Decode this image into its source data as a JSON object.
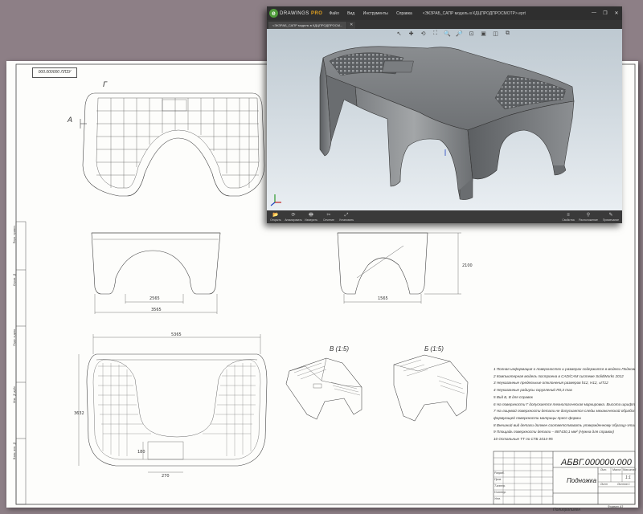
{
  "drawing": {
    "stamp_code": "000.000000 ЛЛЗУ",
    "view_labels": {
      "detail": "Г",
      "section": "А"
    },
    "section_labels": [
      "В (1:5)",
      "Б (1:5)"
    ],
    "dims": {
      "top_width": "2565",
      "top_width2": "3565",
      "side_width": "1565",
      "side_height": "2100",
      "plan_width": "5365",
      "plan_height": "3632",
      "plan_small_w": "270",
      "plan_small_h": "180"
    },
    "notes": [
      "1  Полная информация о поверхностях и размерах содержится в модели Подножка.SLDPRT",
      "2  Компьютерная модель построена в CAD/CAM системе SolidWorks 2012",
      "3  Неуказанные предельные отклонения размеров h12, H12, ±IT12",
      "4  Неуказанные радиусы скруглений R0,3 max",
      "5  Вид Б, В для справок",
      "6  На поверхности Г допускается технологическая маркировка. Высота шрифта 0,5 max",
      "7  На лицевой поверхности детали не допускается следы механической обработки",
      "   формующей поверхности матрицы пресс-формы",
      "8  Внешний вид детали должен соответствовать утвержденному образцу-эталону",
      "9  Площадь поверхности детали – 887430,1 мм² (Нужна для справок)",
      "10  Остальные ТТ по СТБ 1014-95"
    ],
    "title_block": {
      "code": "АБВГ.000000.000",
      "name": "Подножка",
      "material": "Полипропилен",
      "scale": "1:1",
      "sheet": "Лист",
      "sheets": "Листов 1",
      "format": "Формат A3",
      "labels": [
        "Лит.",
        "Масса",
        "Масштаб"
      ],
      "roles": [
        "Разраб.",
        "Пров.",
        "Т.контр.",
        "Н.контр.",
        "Утв."
      ]
    },
    "side_stamp": [
      "Перв. примен.",
      "Справ. №",
      "Подп. и дата",
      "Инв. № дубл.",
      "Взам. инв. №",
      "Подп. и дата",
      "Инв. № подл."
    ]
  },
  "edrawings": {
    "logo_text": "DRAWINGS",
    "logo_pro": "PRO",
    "menu": [
      "Файл",
      "Вид",
      "Инструменты",
      "Справка"
    ],
    "title": "<ЭКЗРАБ_САПР модель в КДЦПРОДПРОСМОТР>.eprt",
    "window_controls": [
      "—",
      "❐",
      "✕"
    ],
    "tab_label": "<ЭКЗРАБ_САПР модель в КДЦПРОДПРОСМ...",
    "tab_close": "✕",
    "bottom_tools": [
      {
        "icon": "📂",
        "label": "Открыть"
      },
      {
        "icon": "⟳",
        "label": "Анимировать"
      },
      {
        "icon": "🖶",
        "label": "Измерить"
      },
      {
        "icon": "✂",
        "label": "Сечение"
      },
      {
        "icon": "⤢",
        "label": "Установить"
      }
    ],
    "bottom_right_tools": [
      {
        "icon": "≡",
        "label": "Свойства"
      },
      {
        "icon": "⚲",
        "label": "Расположение"
      },
      {
        "icon": "✎",
        "label": "Примечание"
      }
    ],
    "view_tools": [
      "↖",
      "✚",
      "⟲",
      "⛶",
      "🔍",
      "🔎",
      "⊡",
      "▣",
      "◫",
      "⧉"
    ]
  }
}
